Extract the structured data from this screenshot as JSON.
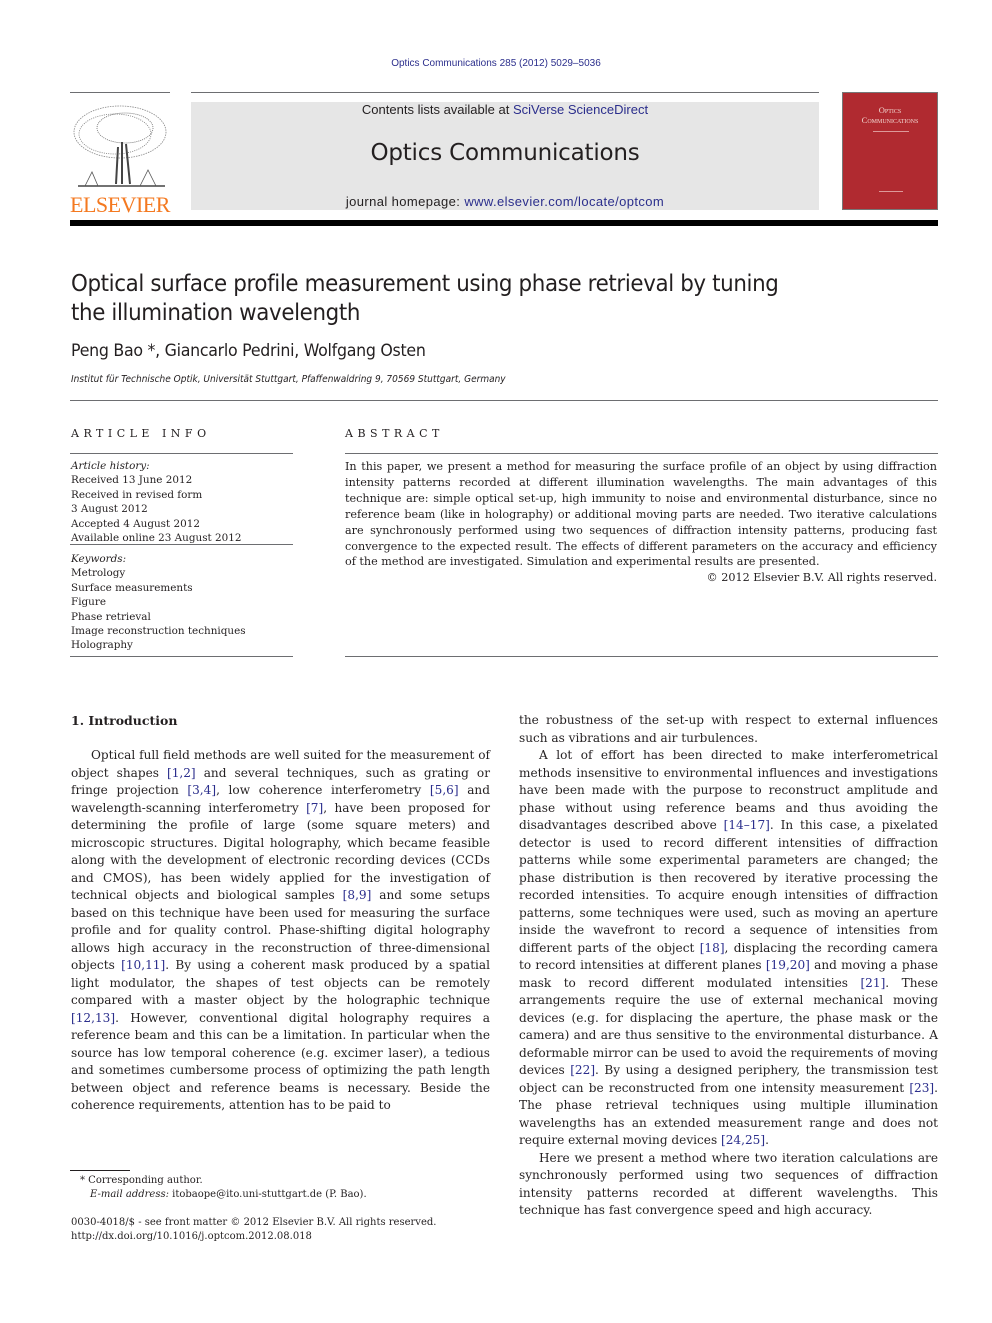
{
  "citation": "Optics Communications 285 (2012) 5029–5036",
  "banner": {
    "contents_prefix": "Contents lists available at ",
    "contents_link": "SciVerse ScienceDirect",
    "journal_title": "Optics Communications",
    "homepage_prefix": "journal homepage: ",
    "homepage_link": "www.elsevier.com/locate/optcom"
  },
  "publisher_logo": "ELSEVIER",
  "cover": {
    "line1": "Optics",
    "line2": "Communications"
  },
  "colors": {
    "link": "#2b2e8c",
    "elsevier_orange": "#f47920",
    "cover_red": "#b02a30",
    "banner_gray": "#e6e6e6"
  },
  "article": {
    "title": "Optical surface profile measurement using phase retrieval by tuning the illumination wavelength",
    "authors": "Peng Bao *, Giancarlo Pedrini, Wolfgang Osten",
    "affiliation": "Institut für Technische Optik, Universität Stuttgart, Pfaffenwaldring 9, 70569 Stuttgart, Germany"
  },
  "article_info": {
    "heading": "ARTICLE INFO",
    "history_label": "Article history:",
    "history": [
      "Received 13 June 2012",
      "Received in revised form",
      "3 August 2012",
      "Accepted 4 August 2012",
      "Available online 23 August 2012"
    ],
    "keywords_label": "Keywords:",
    "keywords": [
      "Metrology",
      "Surface measurements",
      "Figure",
      "Phase retrieval",
      "Image reconstruction techniques",
      "Holography"
    ]
  },
  "abstract": {
    "heading": "ABSTRACT",
    "text": "In this paper, we present a method for measuring the surface profile of an object by using diffraction intensity patterns recorded at different illumination wavelengths. The main advantages of this technique are: simple optical set-up, high immunity to noise and environmental disturbance, since no reference beam (like in holography) or additional moving parts are needed. Two iterative calculations are synchronously performed using two sequences of diffraction intensity patterns, producing fast convergence to the expected result. The effects of different parameters on the accuracy and efficiency of the method are investigated. Simulation and experimental results are presented.",
    "copyright": "© 2012 Elsevier B.V. All rights reserved."
  },
  "intro": {
    "heading": "1.  Introduction",
    "left_p1": [
      {
        "t": "Optical full field methods are well suited for the measurement of object shapes "
      },
      {
        "r": "[1,2]"
      },
      {
        "t": " and several techniques, such as grating or fringe projection "
      },
      {
        "r": "[3,4]"
      },
      {
        "t": ", low coherence interferometry "
      },
      {
        "r": "[5,6]"
      },
      {
        "t": " and wavelength-scanning interferometry "
      },
      {
        "r": "[7]"
      },
      {
        "t": ", have been proposed for determining the profile of large (some square meters) and microscopic structures. Digital holography, which became feasible along with the development of electronic recording devices (CCDs and CMOS), has been widely applied for the investigation of technical objects and biological samples "
      },
      {
        "r": "[8,9]"
      },
      {
        "t": " and some setups based on this technique have been used for measuring the surface profile and for quality control. Phase-shifting digital holography allows high accuracy in the reconstruction of three-dimensional objects "
      },
      {
        "r": "[10,11]"
      },
      {
        "t": ". By using a coherent mask produced by a spatial light modulator, the shapes of test objects can be remotely compared with a master object by the holographic technique "
      },
      {
        "r": "[12,13]"
      },
      {
        "t": ". However, conventional digital holography requires a reference beam and this can be a limitation. In particular when the source has low temporal coherence (e.g. excimer laser), a tedious and sometimes cumbersome process of optimizing the path length between object and reference beams is necessary. Beside the coherence requirements, attention has to be paid to"
      }
    ],
    "right_p0": "the robustness of the set-up with respect to external influences such as vibrations and air turbulences.",
    "right_p1": [
      {
        "t": "A lot of effort has been directed to make interferometrical methods insensitive to environmental influences and investigations have been made with the purpose to reconstruct amplitude and phase without using reference beams and thus avoiding the disadvantages described above "
      },
      {
        "r": "[14–17]"
      },
      {
        "t": ". In this case, a pixelated detector is used to record different intensities of diffraction patterns while some experimental parameters are changed; the phase distribution is then recovered by iterative processing the recorded intensities. To acquire enough intensities of diffraction patterns, some techniques were used, such as moving an aperture inside the wavefront to record a sequence of intensities from different parts of the object "
      },
      {
        "r": "[18]"
      },
      {
        "t": ", displacing the recording camera to record intensities at different planes "
      },
      {
        "r": "[19,20]"
      },
      {
        "t": " and moving a phase mask to record different modulated intensities "
      },
      {
        "r": "[21]"
      },
      {
        "t": ". These arrangements require the use of external mechanical moving devices (e.g. for displacing the aperture, the phase mask or the camera) and are thus sensitive to the environmental disturbance. A deformable mirror can be used to avoid the requirements of moving devices "
      },
      {
        "r": "[22]"
      },
      {
        "t": ". By using a designed periphery, the transmission test object can be reconstructed from one intensity measurement "
      },
      {
        "r": "[23]"
      },
      {
        "t": ". The phase retrieval techniques using multiple illumination wavelengths has an extended measurement range and does not require external moving devices "
      },
      {
        "r": "[24,25]"
      },
      {
        "t": "."
      }
    ],
    "right_p2": "Here we present a method where two iteration calculations are synchronously performed using two sequences of diffraction intensity patterns recorded at different wavelengths. This technique has fast convergence speed and high accuracy."
  },
  "footnote": {
    "corresponding": "* Corresponding author.",
    "email_label": "E-mail address:",
    "email": " itobaope@ito.uni-stuttgart.de (P. Bao).",
    "issn": "0030-4018/$ - see front matter © 2012 Elsevier B.V. All rights reserved.",
    "doi": "http://dx.doi.org/10.1016/j.optcom.2012.08.018"
  }
}
